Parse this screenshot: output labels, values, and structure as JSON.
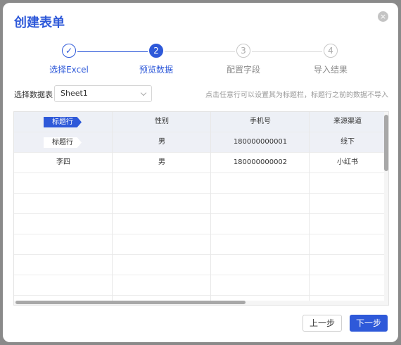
{
  "dialog": {
    "title": "创建表单",
    "close_icon": "×"
  },
  "steps": [
    {
      "label": "选择Excel",
      "state": "done",
      "symbol": "✓"
    },
    {
      "label": "预览数据",
      "state": "active",
      "symbol": "2"
    },
    {
      "label": "配置字段",
      "state": "todo",
      "symbol": "3"
    },
    {
      "label": "导入结果",
      "state": "todo",
      "symbol": "4"
    }
  ],
  "sheet": {
    "label": "选择数据表",
    "selected": "Sheet1",
    "hint": "点击任意行可以设置其为标题栏，标题行之前的数据不导入"
  },
  "table": {
    "header_tag": "标题行",
    "row_tag": "标题行",
    "columns": [
      "性别",
      "手机号",
      "来源渠道"
    ],
    "rows": [
      [
        "男",
        "180000000001",
        "线下"
      ],
      [
        "李四",
        "男",
        "180000000002",
        "小红书"
      ]
    ]
  },
  "footer": {
    "prev": "上一步",
    "next": "下一步"
  },
  "colors": {
    "accent": "#2e59d9"
  }
}
